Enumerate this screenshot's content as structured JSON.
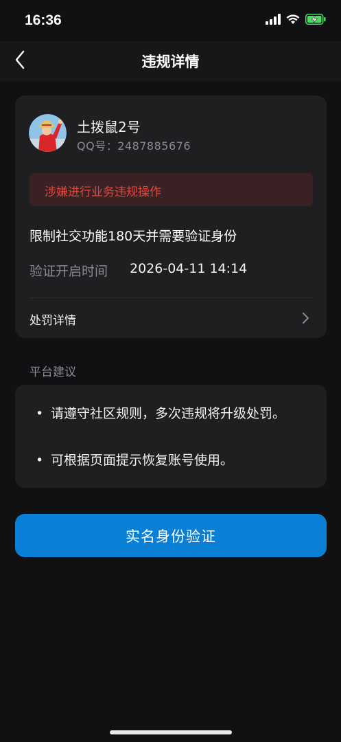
{
  "status_bar": {
    "time": "16:36"
  },
  "nav": {
    "title": "违规详情",
    "back_icon": "chevron-left-icon"
  },
  "violation": {
    "user_name": "土拨鼠2号",
    "qq_label": "QQ号：",
    "qq_number": "2487885676",
    "reason": "涉嫌进行业务违规操作",
    "restriction": "限制社交功能180天并需要验证身份",
    "verify_time_label": "验证开启时间",
    "verify_time_value": "2026-04-11 14:14",
    "penalty_details_label": "处罚详情"
  },
  "advice": {
    "section_title": "平台建议",
    "items": [
      {
        "bullet": "•",
        "text": "请遵守社区规则，多次违规将升级处罚。"
      },
      {
        "bullet": "•",
        "text": "可根据页面提示恢复账号使用。"
      }
    ]
  },
  "actions": {
    "verify_button_label": "实名身份验证"
  },
  "colors": {
    "background": "#111114",
    "card": "#1f1f22",
    "accent_blue": "#0a7fd6",
    "warning_red": "#e0473c",
    "warning_bg": "#3a2224",
    "battery_green": "#4cd964"
  }
}
